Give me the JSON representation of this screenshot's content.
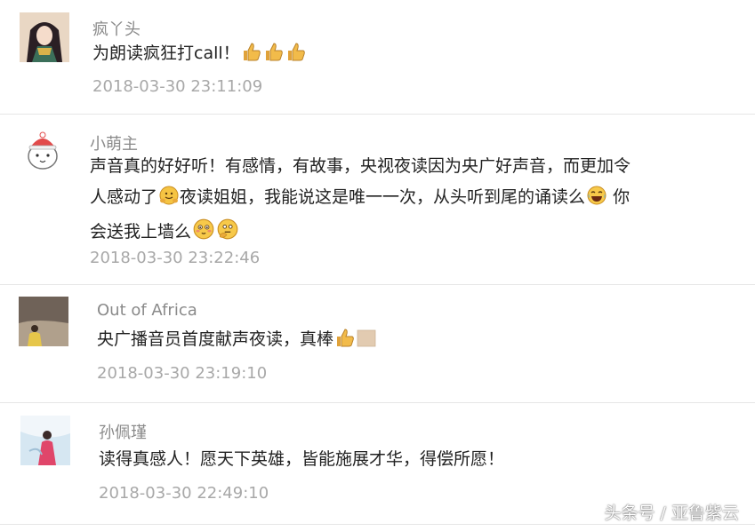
{
  "comments": [
    {
      "username": "疯丫头",
      "text": "为朗读疯狂打call！",
      "time": "2018-03-30 23:11:09",
      "emojis": [
        "thumbs-up",
        "thumbs-up",
        "thumbs-up"
      ]
    },
    {
      "username": "小萌主",
      "text_line1": "声音真的好好听！有感情，有故事，央视夜读因为央广好声音，而更加令",
      "text_line2a": "人感动了",
      "text_line2b": "夜读姐姐，我能说这是唯一一次，从头听到尾的诵读么",
      "text_line2c": " 你",
      "text_line3": "会送我上墙么",
      "time": "2018-03-30 23:22:46",
      "emojis": [
        "hug",
        "laugh-cry",
        "blush",
        "thinking"
      ]
    },
    {
      "username": "Out of Africa",
      "text": "央广播音员首度献声夜读，真棒",
      "time": "2018-03-30 23:19:10",
      "emojis": [
        "thumbs-up",
        "skin-tone"
      ]
    },
    {
      "username": "孙佩瑾",
      "text": "读得真感人！愿天下英雄，皆能施展才华，得偿所愿！",
      "time": "2018-03-30 22:49:10",
      "emojis": []
    }
  ],
  "watermark": "头条号 / 亚鲁紫云"
}
